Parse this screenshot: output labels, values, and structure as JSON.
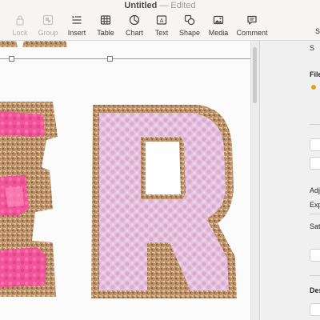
{
  "window": {
    "title": "Untitled",
    "separator": "—",
    "status": "Edited"
  },
  "toolbar": {
    "tools": [
      {
        "label": "Lock",
        "icon": "lock-icon",
        "enabled": false
      },
      {
        "label": "Group",
        "icon": "group-icon",
        "enabled": false
      },
      {
        "label": "Insert",
        "icon": "insert-icon",
        "enabled": true
      },
      {
        "label": "Table",
        "icon": "table-icon",
        "enabled": true
      },
      {
        "label": "Chart",
        "icon": "chart-icon",
        "enabled": true
      },
      {
        "label": "Text",
        "icon": "text-icon",
        "enabled": true
      },
      {
        "label": "Shape",
        "icon": "shape-icon",
        "enabled": true
      },
      {
        "label": "Media",
        "icon": "media-icon",
        "enabled": true
      },
      {
        "label": "Comment",
        "icon": "comment-icon",
        "enabled": true
      }
    ],
    "right_cut_label": "S"
  },
  "canvas": {
    "image_description_colors": {
      "letter_fill": "#e7c6df",
      "letter_texture": "#d9a9cf",
      "glitter_border": "#b88d64",
      "pink_fill": "#f04e93",
      "pink_bright": "#ff5aa0"
    }
  },
  "inspector": {
    "tab_cut_label": "S",
    "file_label": "File",
    "adjust_label": "Adj",
    "exposure_label": "Exp",
    "saturation_label": "Sat",
    "description_label": "Des"
  }
}
